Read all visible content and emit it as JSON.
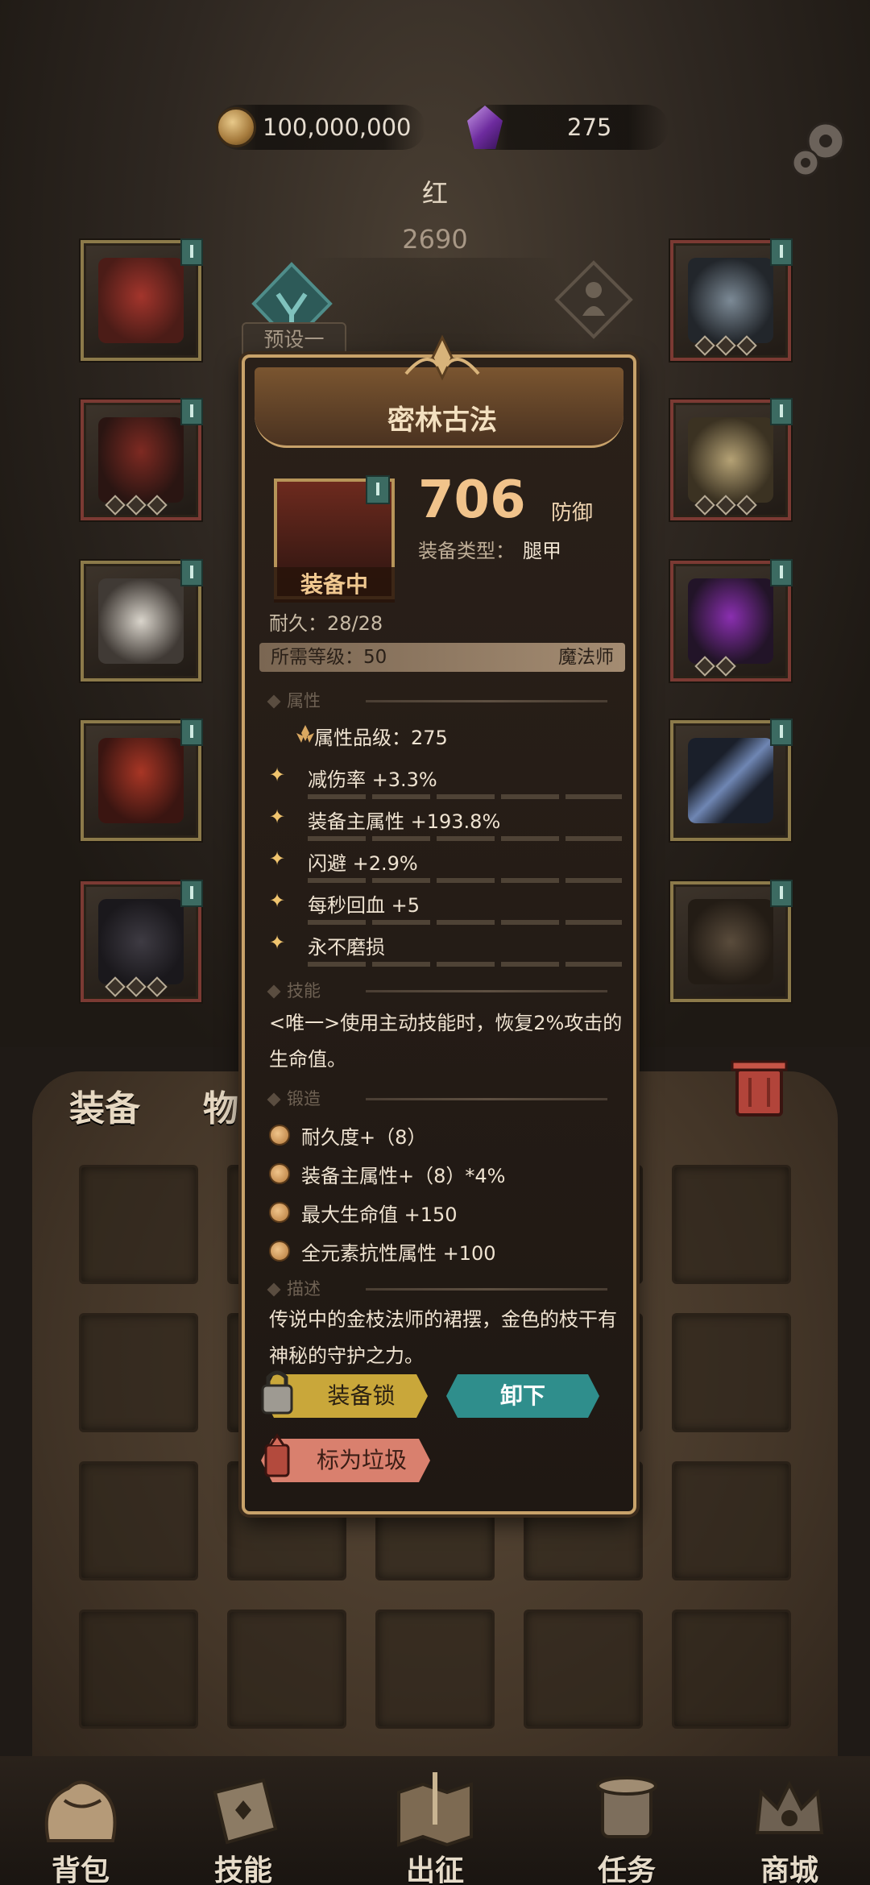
{
  "header": {
    "gold_amount": "100,000,000",
    "gem_amount": "275",
    "hero_name": "红",
    "hero_power": "2690",
    "preset_label": "预设一"
  },
  "item_popup": {
    "title": "密林古法",
    "value": "706",
    "value_label": "防御",
    "type_label": "装备类型：",
    "type_value": "腿甲",
    "status": "装备中",
    "durability": "耐久：28/28",
    "required_level": "所需等级：50",
    "required_class": "魔法师",
    "attributes_heading": "属性",
    "attribute_grade": "属性品级：275",
    "attributes": [
      "减伤率 +3.3%",
      "装备主属性 +193.8%",
      "闪避 +2.9%",
      "每秒回血 +5",
      "永不磨损"
    ],
    "skill_heading": "技能",
    "skill_text": "<唯一>使用主动技能时，恢复2%攻击的生命值。",
    "forge_heading": "锻造",
    "forge_items": [
      "耐久度+（8）",
      "装备主属性+（8）*4%",
      "最大生命值 +150",
      "全元素抗性属性 +100"
    ],
    "description_heading": "描述",
    "description": "传说中的金枝法师的裙摆，金色的枝干有神秘的守护之力。",
    "buttons": {
      "lock": "装备锁",
      "unequip": "卸下",
      "mark_trash": "标为垃圾"
    }
  },
  "bag_tabs": {
    "equipment": "装备",
    "items": "物品"
  },
  "bottom_nav": [
    "背包",
    "技能",
    "出征",
    "任务",
    "商城"
  ]
}
